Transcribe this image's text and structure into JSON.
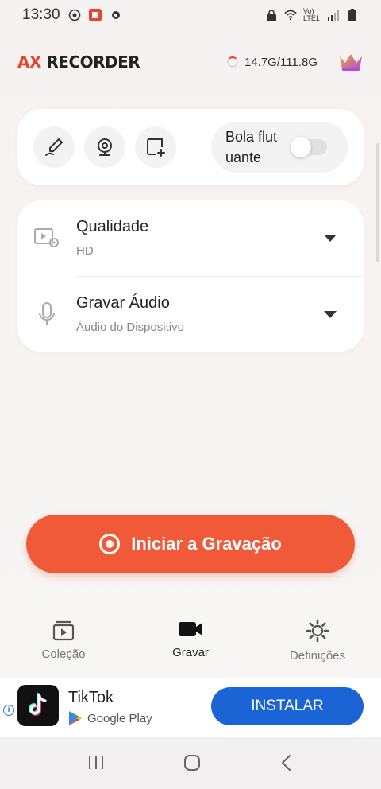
{
  "status_bar": {
    "time": "13:30",
    "network": "Vo) LTE1"
  },
  "header": {
    "logo_accent": "AX",
    "logo_text": "RECORDER",
    "storage": "14.7G/111.8G"
  },
  "tools": {
    "floating_ball_label": "Bola flut uante",
    "floating_ball_on": false
  },
  "settings": {
    "quality": {
      "title": "Qualidade",
      "value": "HD"
    },
    "audio": {
      "title": "Gravar Áudio",
      "value": "Áudio do Dispositivo"
    }
  },
  "record_button": {
    "label": "Iniciar a Gravação"
  },
  "bottom_nav": {
    "items": [
      {
        "label": "Coleção",
        "icon": "collection-icon"
      },
      {
        "label": "Gravar",
        "icon": "camera-icon",
        "active": true
      },
      {
        "label": "Definições",
        "icon": "gear-icon"
      }
    ]
  },
  "ad": {
    "app_name": "TikTok",
    "store": "Google Play",
    "cta": "INSTALAR"
  },
  "colors": {
    "accent": "#f05a38",
    "install_blue": "#1a64d6"
  }
}
